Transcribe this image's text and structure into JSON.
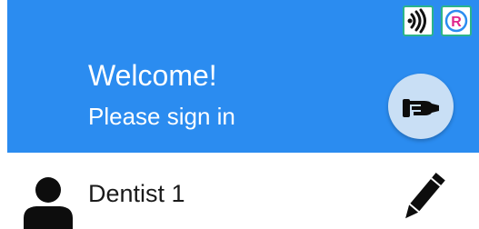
{
  "header": {
    "welcome": "Welcome!",
    "subtitle": "Please sign in",
    "background_color": "#2b8cf0"
  },
  "status_icons": [
    {
      "name": "wireless-signal-icon"
    },
    {
      "name": "registered-mark-icon",
      "glyph": "R"
    }
  ],
  "login_button": {
    "icon": "hand-key-icon"
  },
  "user": {
    "name": "Dentist 1",
    "avatar_icon": "person-icon",
    "edit_icon": "pencil-icon"
  }
}
